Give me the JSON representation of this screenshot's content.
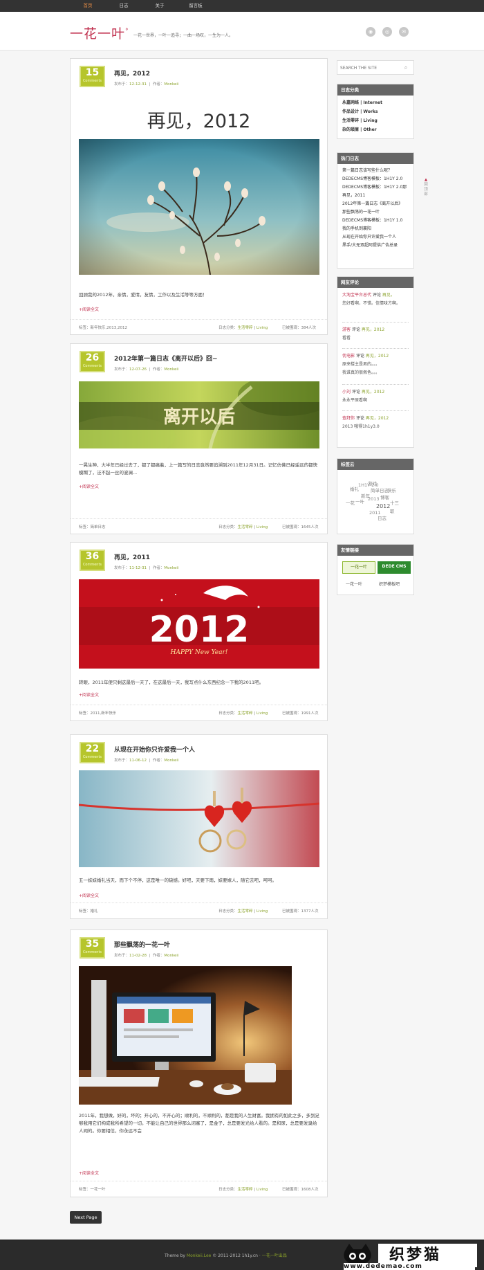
{
  "nav": {
    "items": [
      "首页",
      "日志",
      "关于",
      "留言板"
    ]
  },
  "site": {
    "logo": "一花一叶",
    "logo_mark": "°",
    "slogan": "一花一世界，一叶一追寻；一曲一场叹，一生为一人。"
  },
  "social": {
    "icons": [
      "rss-icon",
      "weibo-icon",
      "mail-icon"
    ],
    "glyphs": [
      "◉",
      "◎",
      "✉"
    ]
  },
  "search": {
    "placeholder": "SEARCH THE SITE",
    "button": "⌕"
  },
  "posts": [
    {
      "day": "15",
      "label": "Comments",
      "title": "再见，2012",
      "meta_prefix": "发布于：",
      "date": "12-12-31",
      "author_prefix": "作者：",
      "author": "Monkeii",
      "image_caption": "再见，2012",
      "excerpt": "回顾我的2012年，亲情，爱情，友情，工作以及生活等等方面！",
      "more": "+阅读全文",
      "tags": "标签：新年快乐,2013,2012",
      "cat_prefix": "日志分类：",
      "cat": "生活零碎",
      "cat2": "Living",
      "views_prefix": "已被围观：",
      "views": "384人次"
    },
    {
      "day": "26",
      "label": "Comments",
      "title": "2012年第一篇日志《离开以后》囧~",
      "meta_prefix": "发布于：",
      "date": "12-07-26",
      "author_prefix": "作者：",
      "author": "Monkeii",
      "image_caption": "离开以后",
      "excerpt": "一晃生神，大半年已经过去了，都了都痛着，上一篇写的日志竟然要追溯到2011年12月31日。记忆仿佛已经遥远的都快模糊了，泛不起一丝的波澜...",
      "more": "+阅读全文",
      "tags": "标签：简单日志",
      "cat_prefix": "日志分类：",
      "cat": "生活零碎",
      "cat2": "Living",
      "views_prefix": "已被围观：",
      "views": "1645人次"
    },
    {
      "day": "36",
      "label": "Comments",
      "title": "再见，2011",
      "meta_prefix": "发布于：",
      "date": "11-12-31",
      "author_prefix": "作者：",
      "author": "Monkeii",
      "image_caption": "2012",
      "image_sub": "HAPPY New Year!",
      "excerpt": "转眼，2011年便只剩这最后一天了，在这最后一天，我写点什么东西纪念一下我的2011吧。",
      "more": "+阅读全文",
      "tags": "标签：2011,新年快乐",
      "cat_prefix": "日志分类：",
      "cat": "生活零碎",
      "cat2": "Living",
      "views_prefix": "已被围观：",
      "views": "1991人次"
    },
    {
      "day": "22",
      "label": "Comments",
      "title": "从现在开始你只许爱我一个人",
      "meta_prefix": "发布于：",
      "date": "11-06-12",
      "author_prefix": "作者：",
      "author": "Monkeii",
      "excerpt": "五一妹妹婚礼当天，而下个不停，这是唯一的缺憾。好吧，天要下雨，妹要嫁人，随它去吧，呵呵。",
      "more": "+阅读全文",
      "tags": "标签：婚礼",
      "cat_prefix": "日志分类：",
      "cat": "生活零碎",
      "cat2": "Living",
      "views_prefix": "已被围观：",
      "views": "1377人次"
    },
    {
      "day": "35",
      "label": "Comments",
      "title": "那些飘荡的一花一叶",
      "meta_prefix": "发布于：",
      "date": "11-02-28",
      "author_prefix": "作者：",
      "author": "Monkeii",
      "excerpt": "2011年，我想做，好的，坏的；开心的，不开心的；顺利的，不顺利的，都是我的人生财富。我拥有的如此之多，多到足够我用它们构成我所希望的一切。不能让自己的世界那么闭塞了，是金子，总是要发光给人看的。是和尿，总是要发臭给人闻的。你要相信，你永远不会",
      "more": "+阅读全文",
      "tags": "标签：一花一叶",
      "cat_prefix": "日志分类：",
      "cat": "生活零碎",
      "cat2": "Living",
      "views_prefix": "已被围观：",
      "views": "1608人次"
    }
  ],
  "sidebar": {
    "categories": {
      "title": "日志分类",
      "items": [
        "永嘉网络 | Internet",
        "作品设计 | Works",
        "生活零碎 | Living",
        "杂的琐屑 | Other"
      ]
    },
    "popular": {
      "title": "热门日志",
      "items": [
        "第一篇日志该写些什么呢？",
        "DEDECMS博客模板：1H1Y 2.0",
        "DEDECMS博客模板：1H1Y 2.0那",
        "再见，2011",
        "2012年第一篇日志《离开以后》",
        "那些飘荡的一花一叶",
        "DEDECMS博客模板：1H1Y 1.0",
        "我的手机到襄阳",
        "从现在开始你只许爱我一个人",
        "黑手/大无双超阿提供广告总录"
      ]
    },
    "comments": {
      "title": "网友评论",
      "items": [
        {
          "who": "大淘宝平台总代",
          "on": "评论",
          "post": "再见，",
          "text": "您好看啊，不错。信情味方啊。"
        },
        {
          "who": "游客",
          "on": "评论",
          "post": "再见，2012",
          "text": "看看"
        },
        {
          "who": "优电影",
          "on": "评论",
          "post": "再见，2012",
          "text": "原来楼主是男的。。。\n我谁真的很佩色。。。"
        },
        {
          "who": "小刘",
          "on": "评论",
          "post": "再见，2012",
          "text": "永永平原看啊"
        },
        {
          "who": "查拜你",
          "on": "评论",
          "post": "再见，2012",
          "text": "2013 哦得1h1y3.0"
        }
      ]
    },
    "tagcloud": {
      "title": "标签云",
      "tags": [
        "婚礼",
        "游戏",
        "2012",
        "2011",
        "新年",
        "简单日志",
        "快乐",
        "一叶",
        "1H1Y 2.0",
        "一花",
        "2013",
        "博客",
        "十三",
        "职",
        "日志"
      ]
    },
    "links": {
      "title": "友情链接",
      "items": [
        "一花一叶",
        "织梦模板吧"
      ],
      "logo1": "一花一叶",
      "logo2": "DEDE CMS"
    }
  },
  "backtop": "回顶部",
  "pagination": {
    "next": "Next Page"
  },
  "footer": {
    "theme": "Theme by",
    "author": "Monkeii.Lee",
    "copy": "© 2011-2012 1h1y.cn ·",
    "out": "一花一叶出品"
  },
  "watermark": {
    "text": "织梦猫",
    "url": "www.dedemao.com"
  }
}
